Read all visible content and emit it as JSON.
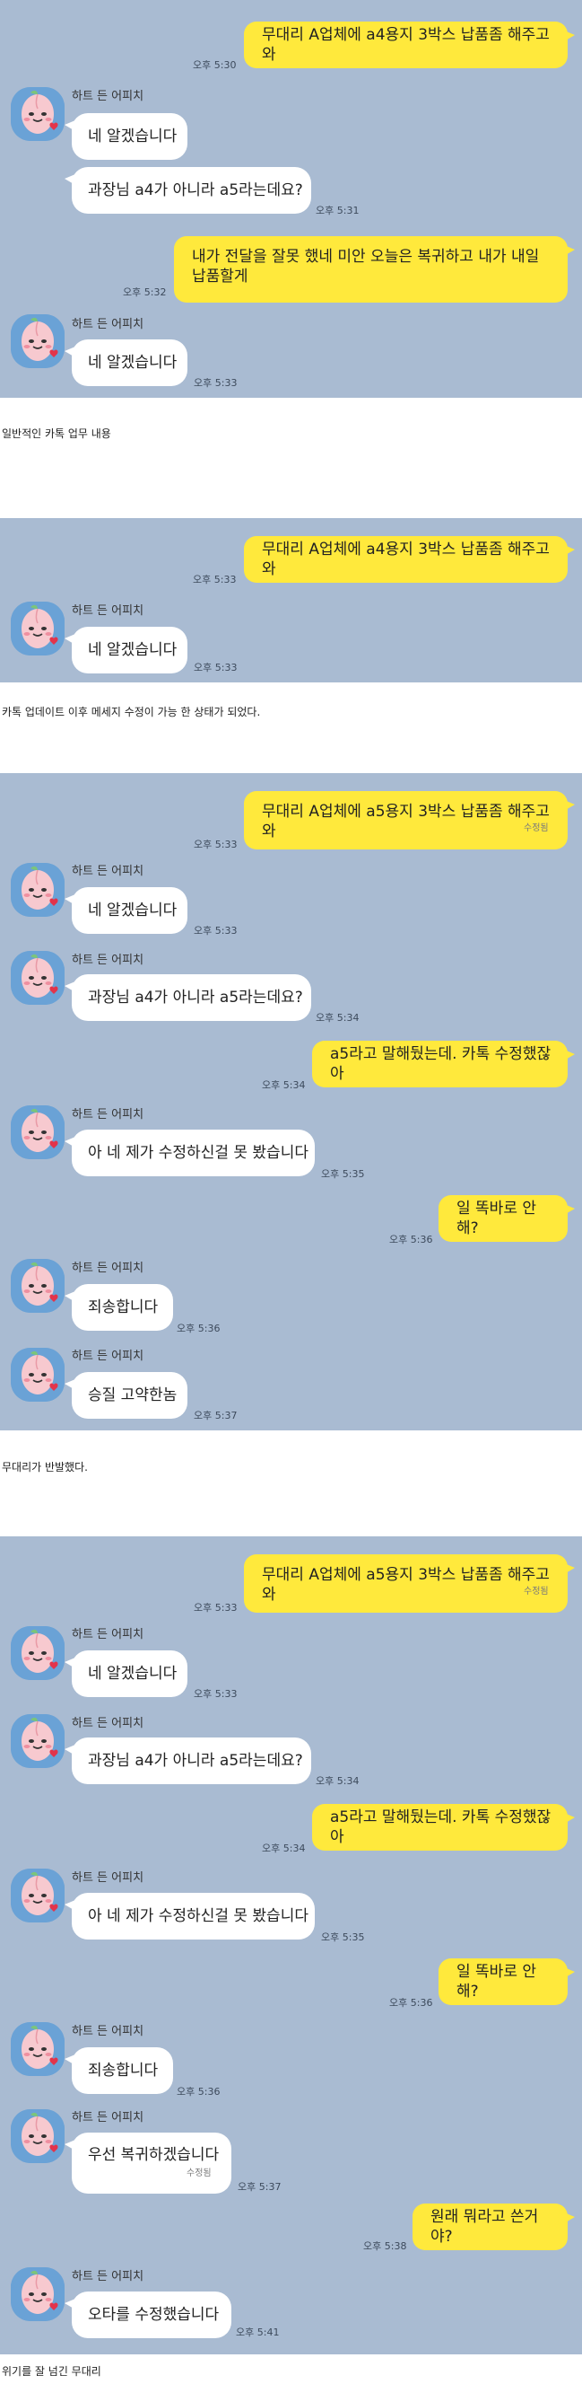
{
  "contact": {
    "name": "하트 든 어피치"
  },
  "labels": {
    "edited": "수정됨"
  },
  "captions": [
    "일반적인 카톡 업무 내용",
    "카톡 업데이트 이후 메세지 수정이 가능 한 상태가 되었다.",
    "무대리가 반발했다.",
    "위기를 잘 넘긴 무대리"
  ],
  "screens": [
    {
      "messages": [
        {
          "side": "out",
          "text": "무대리 A업체에 a4용지 3박스 납품좀 해주고 와",
          "time": "오후 5:30"
        },
        {
          "side": "in",
          "text": "네 알겠습니다"
        },
        {
          "side": "in",
          "text": "과장님 a4가 아니라 a5라는데요?",
          "time": "오후 5:31"
        },
        {
          "side": "out",
          "text": "내가 전달을 잘못 했네 미안 오늘은 복귀하고 내가 내일 납품할게",
          "time": "오후 5:32"
        },
        {
          "side": "in",
          "text": "네 알겠습니다",
          "time": "오후 5:33"
        }
      ]
    },
    {
      "messages": [
        {
          "side": "out",
          "text": "무대리 A업체에 a4용지 3박스 납품좀 해주고 와",
          "time": "오후 5:33"
        },
        {
          "side": "in",
          "text": "네 알겠습니다",
          "time": "오후 5:33"
        }
      ]
    },
    {
      "messages": [
        {
          "side": "out",
          "text": "무대리 A업체에 a5용지 3박스 납품좀 해주고 와",
          "time": "오후 5:33",
          "edited": true
        },
        {
          "side": "in",
          "text": "네 알겠습니다",
          "time": "오후 5:33"
        },
        {
          "side": "in",
          "text": "과장님 a4가 아니라 a5라는데요?",
          "time": "오후 5:34"
        },
        {
          "side": "out",
          "text": "a5라고 말해뒀는데. 카톡 수정했잖아",
          "time": "오후 5:34"
        },
        {
          "side": "in",
          "text": "아 네 제가 수정하신걸 못 봤습니다",
          "time": "오후 5:35"
        },
        {
          "side": "out",
          "text": "일 똑바로 안해?",
          "time": "오후 5:36"
        },
        {
          "side": "in",
          "text": "죄송합니다",
          "time": "오후 5:36"
        },
        {
          "side": "in",
          "text": "승질 고약한놈",
          "time": "오후 5:37"
        }
      ]
    },
    {
      "messages": [
        {
          "side": "out",
          "text": "무대리 A업체에 a5용지 3박스 납품좀 해주고 와",
          "time": "오후 5:33",
          "edited": true
        },
        {
          "side": "in",
          "text": "네 알겠습니다",
          "time": "오후 5:33"
        },
        {
          "side": "in",
          "text": "과장님 a4가 아니라 a5라는데요?",
          "time": "오후 5:34"
        },
        {
          "side": "out",
          "text": "a5라고 말해뒀는데. 카톡 수정했잖아",
          "time": "오후 5:34"
        },
        {
          "side": "in",
          "text": "아 네 제가 수정하신걸 못 봤습니다",
          "time": "오후 5:35"
        },
        {
          "side": "out",
          "text": "일 똑바로 안해?",
          "time": "오후 5:36"
        },
        {
          "side": "in",
          "text": "죄송합니다",
          "time": "오후 5:36"
        },
        {
          "side": "in",
          "text": "우선 복귀하겠습니다",
          "time": "오후 5:37",
          "edited": true
        },
        {
          "side": "out",
          "text": "원래 뭐라고 쓴거야?",
          "time": "오후 5:38"
        },
        {
          "side": "in",
          "text": "오타를 수정했습니다",
          "time": "오후 5:41"
        }
      ]
    }
  ],
  "colors": {
    "chat_background": "#a9bbd2",
    "outgoing_bubble": "#ffe93c",
    "incoming_bubble": "#ffffff",
    "avatar_background": "#6aa2d6"
  }
}
